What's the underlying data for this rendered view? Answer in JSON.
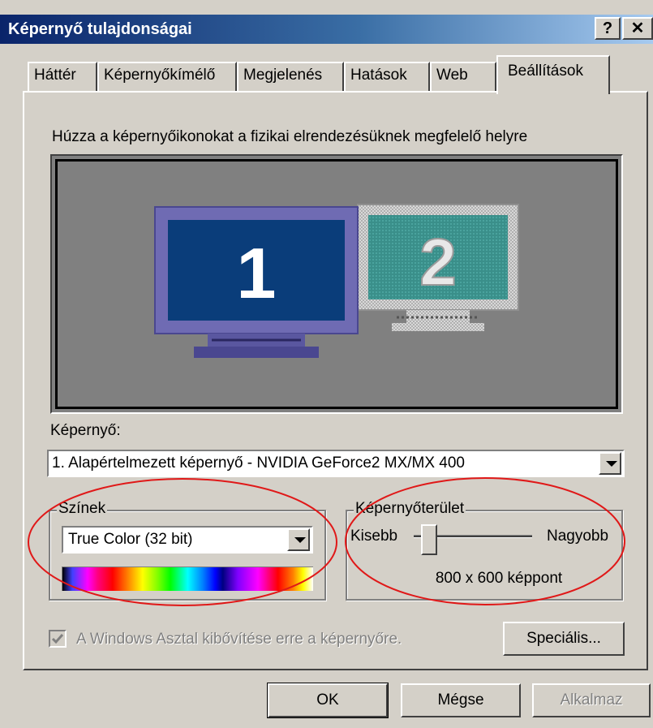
{
  "window": {
    "title": "Képernyő tulajdonságai",
    "help_button": "?",
    "close_button": "✕"
  },
  "tabs": [
    "Háttér",
    "Képernyőkímélő",
    "Megjelenés",
    "Hatások",
    "Web",
    "Beállítások"
  ],
  "active_tab": "Beállítások",
  "instruction": "Húzza a képernyőikonokat a fizikai elrendezésüknek megfelelő helyre",
  "monitors": [
    {
      "label": "1",
      "primary": true
    },
    {
      "label": "2",
      "primary": false
    }
  ],
  "display": {
    "label": "Képernyő:",
    "selected": "1. Alapértelmezett képernyő - NVIDIA GeForce2 MX/MX 400"
  },
  "colors": {
    "group_label": "Színek",
    "selected": "True Color (32 bit)"
  },
  "screen_area": {
    "group_label": "Képernyőterület",
    "min_label": "Kisebb",
    "max_label": "Nagyobb",
    "value_text": "800 x 600 képpont",
    "slider_position_fraction": 0.1
  },
  "extend_desktop": {
    "label": "A Windows Asztal kibővítése erre a képernyőre.",
    "checked": true,
    "enabled": false
  },
  "buttons": {
    "advanced": "Speciális...",
    "ok": "OK",
    "cancel": "Mégse",
    "apply": "Alkalmaz"
  },
  "theme": {
    "face": "#d4d0c8",
    "titlebar_start": "#0a246a",
    "monitor1_bezel": "#6f6bb3",
    "monitor1_screen": "#0a3d7a",
    "monitor2_screen": "#3a8f8a",
    "annotation": "#e01818"
  }
}
